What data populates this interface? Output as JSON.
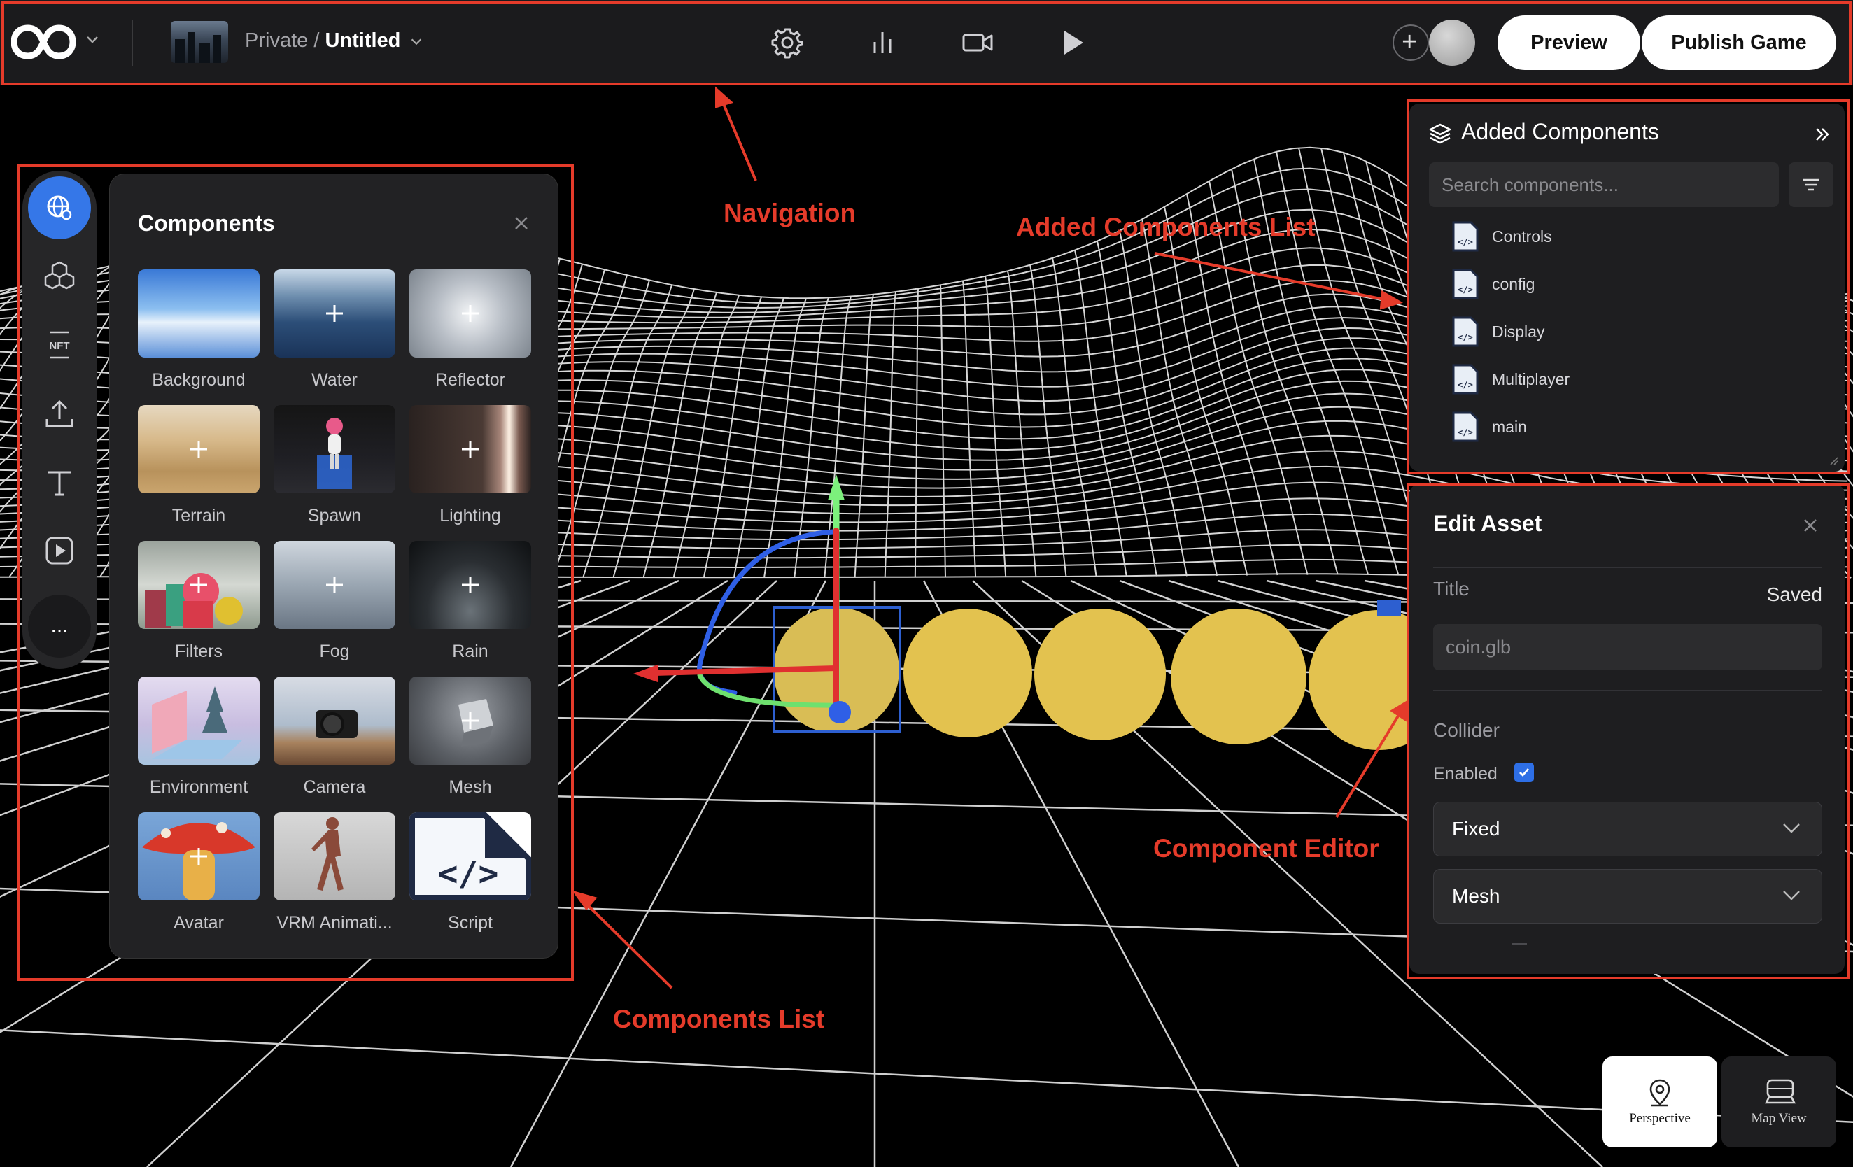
{
  "navigation": {
    "breadcrumb_private": "Private /",
    "breadcrumb_title": "Untitled",
    "icons": [
      "settings-icon",
      "analytics-icon",
      "camera-icon",
      "play-icon"
    ],
    "preview_label": "Preview",
    "publish_label": "Publish Game"
  },
  "annotations": {
    "navigation": "Navigation",
    "added_components_list": "Added Components List",
    "component_editor": "Component Editor",
    "components_list": "Components List",
    "color": "#e53b2a"
  },
  "rail": {
    "items": [
      "globe-icon",
      "cubes-icon",
      "nft-icon",
      "upload-icon",
      "text-icon",
      "video-icon"
    ],
    "more_label": "..."
  },
  "components_panel": {
    "title": "Components",
    "items": [
      {
        "label": "Background"
      },
      {
        "label": "Water"
      },
      {
        "label": "Reflector"
      },
      {
        "label": "Terrain"
      },
      {
        "label": "Spawn"
      },
      {
        "label": "Lighting"
      },
      {
        "label": "Filters"
      },
      {
        "label": "Fog"
      },
      {
        "label": "Rain"
      },
      {
        "label": "Environment"
      },
      {
        "label": "Camera"
      },
      {
        "label": "Mesh"
      },
      {
        "label": "Avatar"
      },
      {
        "label": "VRM Animati..."
      },
      {
        "label": "Script"
      }
    ]
  },
  "added_panel": {
    "title": "Added Components",
    "search_placeholder": "Search components...",
    "items": [
      {
        "label": "Controls"
      },
      {
        "label": "config"
      },
      {
        "label": "Display"
      },
      {
        "label": "Multiplayer"
      },
      {
        "label": "main"
      }
    ]
  },
  "edit_panel": {
    "title": "Edit Asset",
    "title_label": "Title",
    "saved_status": "Saved",
    "title_placeholder": "coin.glb",
    "collider_label": "Collider",
    "enabled_label": "Enabled",
    "enabled_checked": true,
    "collider_type": "Fixed",
    "collider_shape": "Mesh"
  },
  "view_toggle": {
    "perspective_label": "Perspective",
    "mapview_label": "Map View",
    "active": "Perspective"
  },
  "colors": {
    "accent_blue": "#3577e8",
    "coin_yellow": "#e3c24f",
    "panel_bg": "#222224"
  }
}
